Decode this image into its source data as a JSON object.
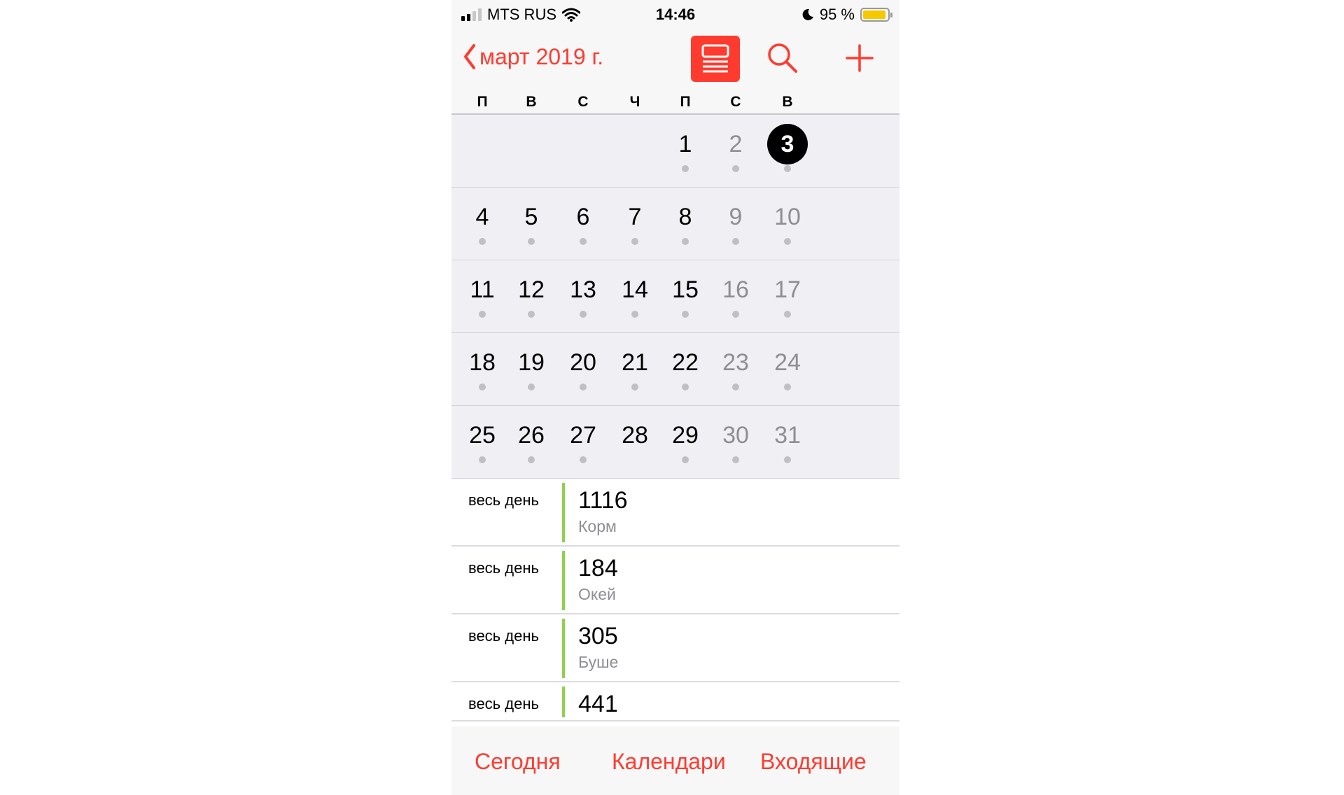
{
  "status_bar": {
    "carrier": "MTS RUS",
    "time": "14:46",
    "battery": "95 %",
    "battery_level": 0.95,
    "icons": [
      "signal-icon",
      "wifi-icon",
      "moon-icon",
      "battery-icon"
    ]
  },
  "header": {
    "back_label": "март 2019 г.",
    "icons": [
      "chevron-left-icon",
      "list-view-icon",
      "search-icon",
      "plus-icon"
    ]
  },
  "weekdays": [
    "П",
    "В",
    "С",
    "Ч",
    "П",
    "С",
    "В"
  ],
  "calendar": {
    "today": "3",
    "weeks": [
      [
        "",
        "",
        "",
        "",
        "1",
        "2",
        "3"
      ],
      [
        "4",
        "5",
        "6",
        "7",
        "8",
        "9",
        "10"
      ],
      [
        "11",
        "12",
        "13",
        "14",
        "15",
        "16",
        "17"
      ],
      [
        "18",
        "19",
        "20",
        "21",
        "22",
        "23",
        "24"
      ],
      [
        "25",
        "26",
        "27",
        "28",
        "29",
        "30",
        "31"
      ]
    ],
    "event_days": [
      "1",
      "2",
      "3",
      "4",
      "5",
      "6",
      "7",
      "8",
      "9",
      "10",
      "11",
      "12",
      "13",
      "14",
      "15",
      "16",
      "17",
      "18",
      "19",
      "20",
      "21",
      "22",
      "23",
      "24",
      "25",
      "26",
      "27",
      "29",
      "30",
      "31"
    ]
  },
  "events": [
    {
      "time": "весь день",
      "title": "1116",
      "subtitle": "Корм"
    },
    {
      "time": "весь день",
      "title": "184",
      "subtitle": "Окей"
    },
    {
      "time": "весь день",
      "title": "305",
      "subtitle": "Буше"
    },
    {
      "time": "весь день",
      "title": "441",
      "subtitle": ""
    }
  ],
  "tab_bar": {
    "today": "Сегодня",
    "calendars": "Календари",
    "inbox": "Входящие"
  },
  "colors": {
    "accent": "#ff3b30",
    "event_bar": "#8fd14f",
    "battery": "#f5c800",
    "weekend_text": "#8e8e93"
  }
}
